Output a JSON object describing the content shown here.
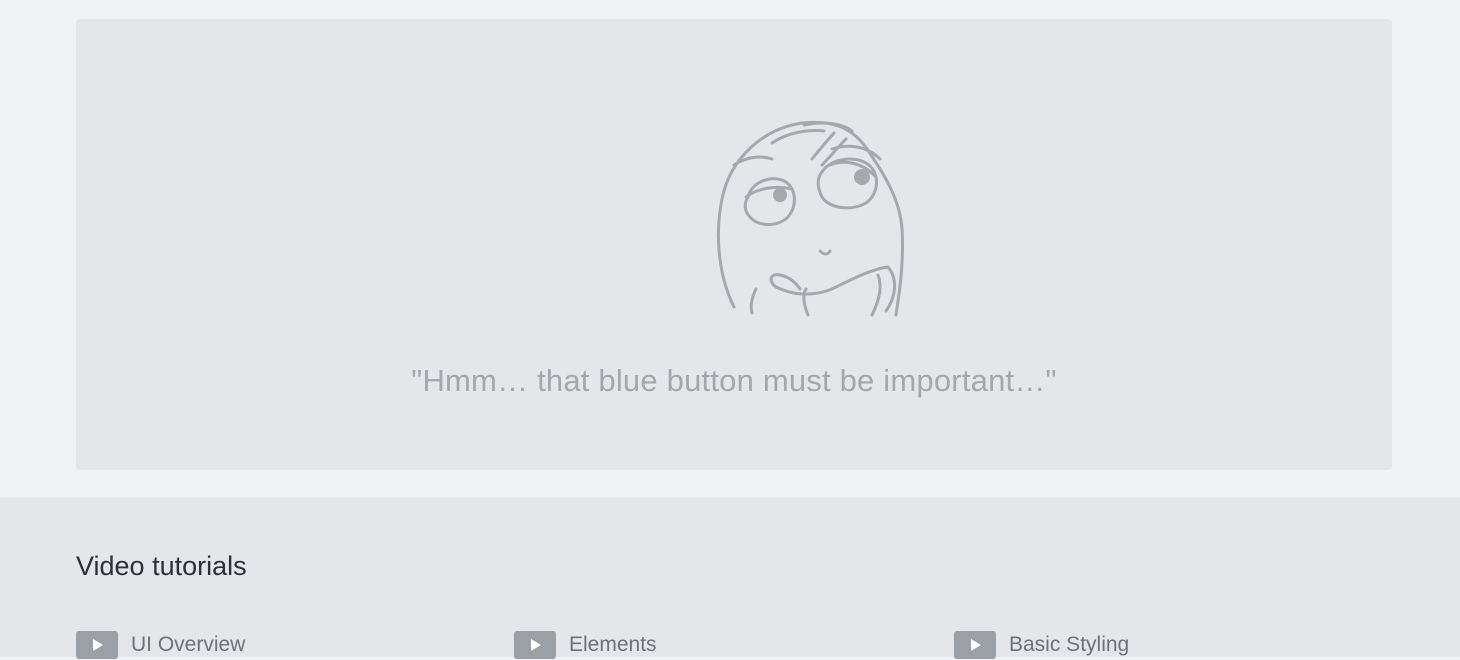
{
  "empty_state": {
    "illustration": "thinking-face-icon",
    "message": "\"Hmm… that blue button must be important…\""
  },
  "tutorials": {
    "title": "Video tutorials",
    "items": [
      {
        "label": "UI Overview",
        "icon": "play-icon"
      },
      {
        "label": "Elements",
        "icon": "play-icon"
      },
      {
        "label": "Basic Styling",
        "icon": "play-icon"
      }
    ]
  },
  "colors": {
    "page_background": "#f0f2f6",
    "card_background": "#e5e6ea",
    "muted_text": "#a3a8ad",
    "title_text": "#2c3138",
    "link_text": "#6c7278",
    "icon_gray": "#9aa0a6"
  }
}
